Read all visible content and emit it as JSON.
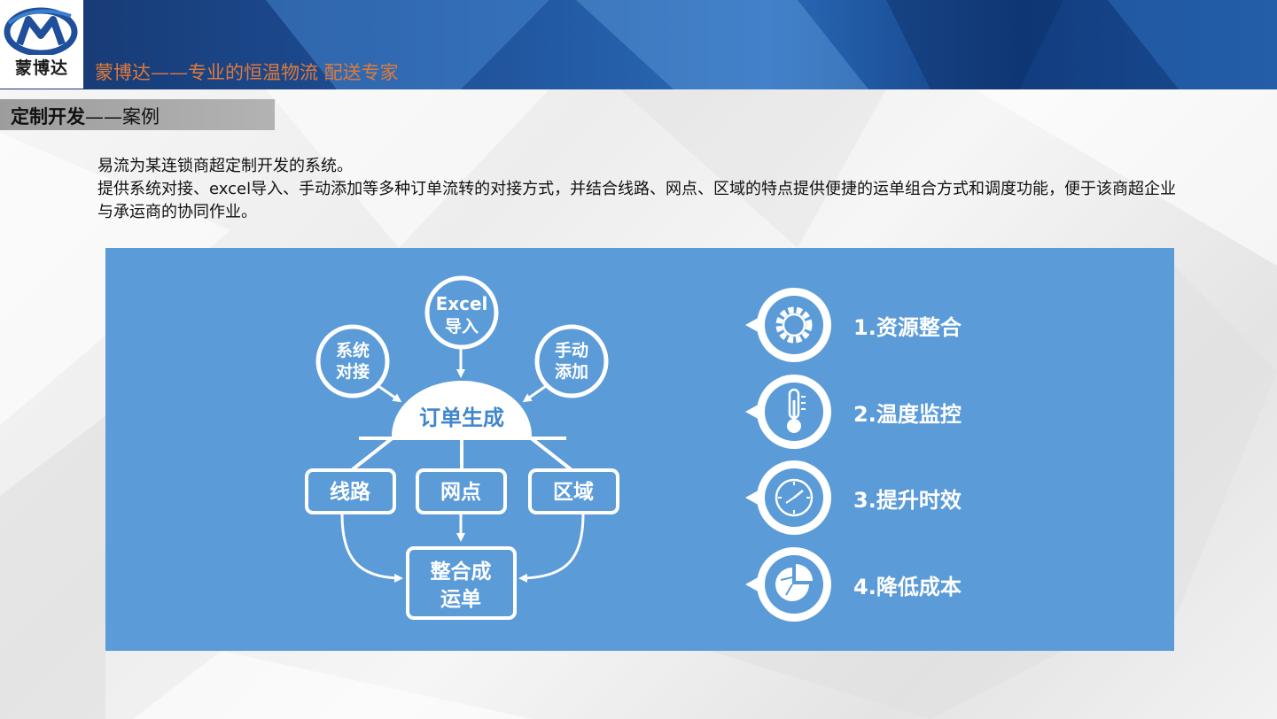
{
  "header": {
    "logo_text": "蒙博达",
    "slogan": "蒙博达——专业的恒温物流 配送专家"
  },
  "section": {
    "title_bold": "定制开发",
    "title_rest": "——案例"
  },
  "description": {
    "line1": "易流为某连锁商超定制开发的系统。",
    "line2": "提供系统对接、excel导入、手动添加等多种订单流转的对接方式，并结合线路、网点、区域的特点提供便捷的运单组合方式和调度功能，便于该商超企业与承运商的协同作业。"
  },
  "diagram": {
    "inputs": {
      "system": [
        "系统",
        "对接"
      ],
      "excel": [
        "Excel",
        "导入"
      ],
      "manual": [
        "手动",
        "添加"
      ]
    },
    "order_generation": "订单生成",
    "branches": {
      "route": "线路",
      "outlet": "网点",
      "region": "区域"
    },
    "result": [
      "整合成",
      "运单"
    ]
  },
  "features": [
    {
      "label": "1.资源整合",
      "icon": "gear-icon"
    },
    {
      "label": "2.温度监控",
      "icon": "thermometer-icon"
    },
    {
      "label": "3.提升时效",
      "icon": "clock-icon"
    },
    {
      "label": "4.降低成本",
      "icon": "pie-chart-icon"
    }
  ],
  "colors": {
    "panel": "#5a9bd8",
    "header": "#1d4d93",
    "slogan": "#e07a3a"
  }
}
